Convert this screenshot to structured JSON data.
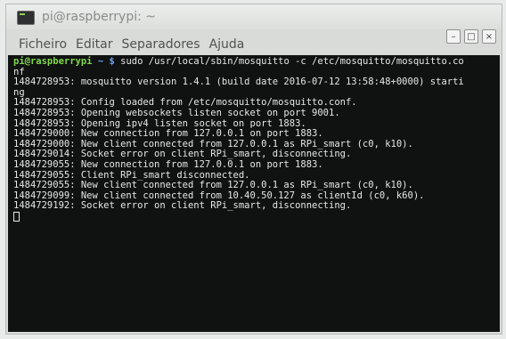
{
  "window": {
    "title": "pi@raspberrypi: ~",
    "buttons": {
      "minimize": "–",
      "maximize": "□",
      "close": "×"
    }
  },
  "menu": [
    "Ficheiro",
    "Editar",
    "Separadores",
    "Ajuda"
  ],
  "prompt": {
    "user_host": "pi@raspberrypi",
    "path": " ~ $",
    "command": " sudo /usr/local/sbin/mosquitto -c /etc/mosquitto/mosquitto.co",
    "wrap": "nf"
  },
  "output_lines": [
    "1484728953: mosquitto version 1.4.1 (build date 2016-07-12 13:58:48+0000) starti",
    "ng",
    "1484728953: Config loaded from /etc/mosquitto/mosquitto.conf.",
    "1484728953: Opening websockets listen socket on port 9001.",
    "1484728953: Opening ipv4 listen socket on port 1883.",
    "1484729000: New connection from 127.0.0.1 on port 1883.",
    "1484729000: New client connected from 127.0.0.1 as RPi_smart (c0, k10).",
    "1484729014: Socket error on client RPi_smart, disconnecting.",
    "1484729055: New connection from 127.0.0.1 on port 1883.",
    "1484729055: Client RPi_smart disconnected.",
    "1484729055: New client connected from 127.0.0.1 as RPi_smart (c0, k10).",
    "1484729099: New client connected from 10.40.50.127 as clientId (c0, k60).",
    "1484729192: Socket error on client RPi_smart, disconnecting."
  ],
  "colors": {
    "terminal_bg": "#101111",
    "prompt_user": "#7fd84b",
    "prompt_path": "#6a9ff0"
  }
}
